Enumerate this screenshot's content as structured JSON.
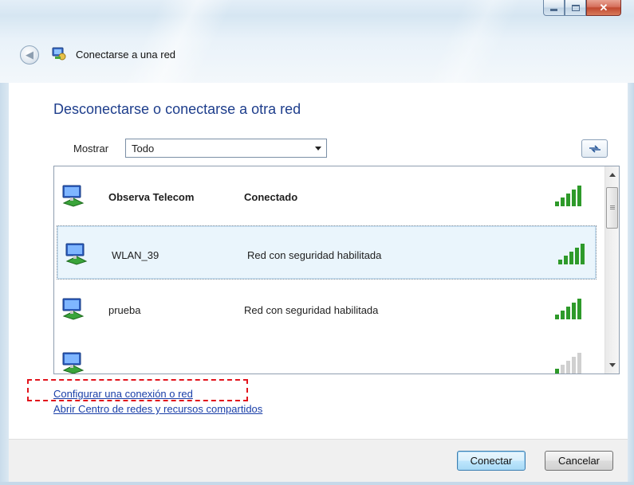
{
  "window": {
    "title": "Conectarse a una red",
    "controls": {
      "minimize": "minimize",
      "maximize": "maximize",
      "close": "close"
    }
  },
  "nav": {
    "back_icon": "back-arrow-icon",
    "app_icon": "network-connect-icon"
  },
  "heading": "Desconectarse o conectarse a otra red",
  "filter": {
    "label": "Mostrar",
    "selected": "Todo"
  },
  "networks": [
    {
      "name": "Observa Telecom",
      "status": "Conectado",
      "bold": true,
      "signal_bars": 5,
      "selected": false
    },
    {
      "name": "WLAN_39",
      "status": "Red con seguridad habilitada",
      "bold": false,
      "signal_bars": 5,
      "selected": true
    },
    {
      "name": "prueba",
      "status": "Red con seguridad habilitada",
      "bold": false,
      "signal_bars": 5,
      "selected": false
    },
    {
      "name": "",
      "status": "",
      "bold": false,
      "signal_bars": 1,
      "selected": false
    }
  ],
  "links": {
    "setup": "Configurar una conexión o red",
    "network_center": "Abrir Centro de redes y recursos compartidos"
  },
  "buttons": {
    "connect": "Conectar",
    "cancel": "Cancelar"
  },
  "colors": {
    "heading": "#1e3e8c",
    "link": "#1a3fa8",
    "highlight": "#e2141c",
    "signal_green": "#2e9a2a"
  }
}
